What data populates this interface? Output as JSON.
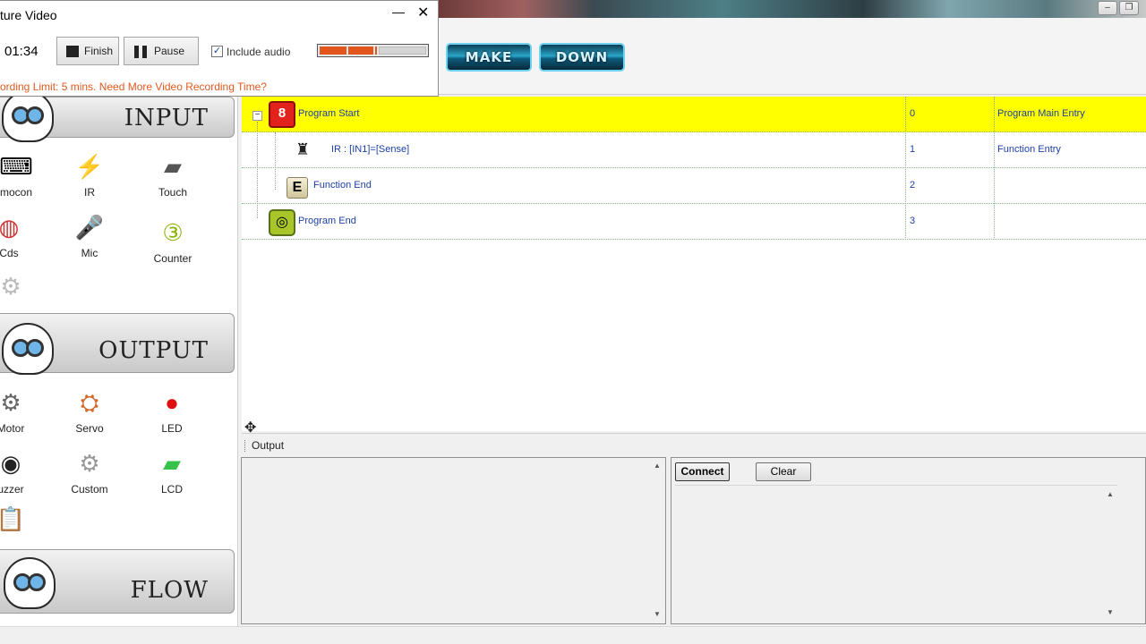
{
  "capture": {
    "title": "ture Video",
    "minimize": "—",
    "close": "✕",
    "timer": "01:34",
    "finish_label": "Finish",
    "pause_label": "Pause",
    "include_audio_label": "Include audio",
    "include_audio_checked": "✓",
    "audio_level": 0.55,
    "limit_text": "ording Limit: 5 mins. Need More Video Recording Time?"
  },
  "window_controls": {
    "minimize": "–",
    "restore": "❐"
  },
  "toolbar": {
    "make_label": "MAKE",
    "down_label": "DOWN"
  },
  "palette": {
    "input": {
      "title": "INPUT",
      "items": [
        {
          "label": "mocon",
          "icon": "remocon-icon"
        },
        {
          "label": "IR",
          "icon": "ir-sensor-icon"
        },
        {
          "label": "Touch",
          "icon": "touch-sensor-icon"
        },
        {
          "label": "Cds",
          "icon": "cds-sensor-icon"
        },
        {
          "label": "Mic",
          "icon": "mic-icon"
        },
        {
          "label": "Counter",
          "icon": "counter-icon"
        }
      ]
    },
    "output": {
      "title": "OUTPUT",
      "items": [
        {
          "label": "Motor",
          "icon": "motor-icon"
        },
        {
          "label": "Servo",
          "icon": "servo-icon"
        },
        {
          "label": "LED",
          "icon": "led-icon"
        },
        {
          "label": "uzzer",
          "icon": "buzzer-icon"
        },
        {
          "label": "Custom",
          "icon": "gear-icon"
        },
        {
          "label": "LCD",
          "icon": "lcd-icon"
        }
      ]
    },
    "flow": {
      "title": "FLOW"
    }
  },
  "program": {
    "rows": [
      {
        "label": "Program Start",
        "index": "0",
        "description": "Program Main Entry"
      },
      {
        "label": "IR : [IN1]=[Sense]",
        "index": "1",
        "description": "Function Entry"
      },
      {
        "label": "Function End",
        "index": "2",
        "description": ""
      },
      {
        "label": "Program End",
        "index": "3",
        "description": ""
      }
    ],
    "highlight_color": "#ffff00"
  },
  "output_panel": {
    "title": "Output",
    "connect_label": "Connect",
    "clear_label": "Clear"
  }
}
